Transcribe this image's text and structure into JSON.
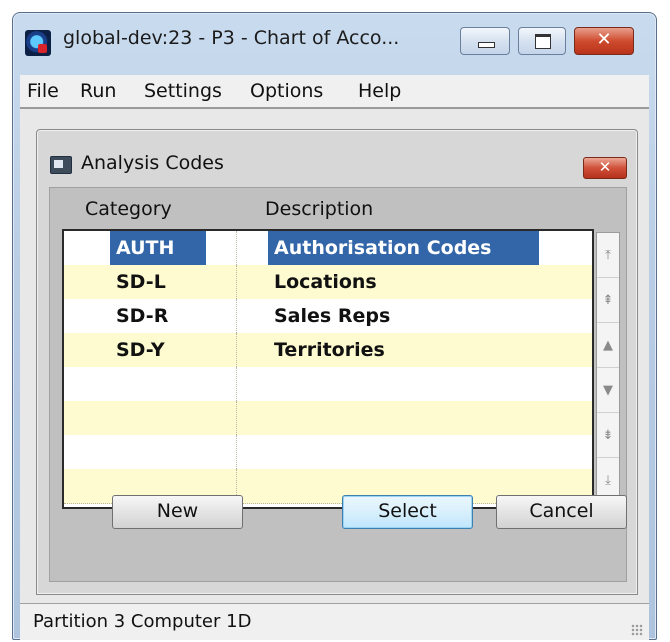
{
  "window": {
    "title": "global-dev:23 - P3 - Chart of Acco...",
    "minimize_glyph": "",
    "maximize_glyph": "",
    "close_glyph": "✕"
  },
  "menu": [
    "File",
    "Run",
    "Settings",
    "Options",
    "Help"
  ],
  "dialog": {
    "title": "Analysis Codes",
    "close_glyph": "✕",
    "columns": {
      "category": "Category",
      "description": "Description"
    },
    "rows": [
      {
        "category": "AUTH",
        "description": "Authorisation Codes",
        "selected": true
      },
      {
        "category": "SD-L",
        "description": "Locations",
        "selected": false
      },
      {
        "category": "SD-R",
        "description": "Sales Reps",
        "selected": false
      },
      {
        "category": "SD-Y",
        "description": "Territories",
        "selected": false
      },
      {
        "category": "",
        "description": "",
        "selected": false
      },
      {
        "category": "",
        "description": "",
        "selected": false
      },
      {
        "category": "",
        "description": "",
        "selected": false
      },
      {
        "category": "",
        "description": "",
        "selected": false
      }
    ],
    "scroll_buttons": [
      {
        "name": "scroll-top-icon",
        "glyph": "⤒"
      },
      {
        "name": "scroll-page-up-icon",
        "glyph": "⇞"
      },
      {
        "name": "scroll-up-icon",
        "glyph": "▲"
      },
      {
        "name": "scroll-down-icon",
        "glyph": "▼"
      },
      {
        "name": "scroll-page-down-icon",
        "glyph": "⇟"
      },
      {
        "name": "scroll-bottom-icon",
        "glyph": "⤓"
      }
    ],
    "buttons": {
      "new": "New",
      "select": "Select",
      "cancel": "Cancel"
    },
    "colors": {
      "selection": "#3366a8",
      "row_alt": "#fffbd0",
      "row": "#ffffff"
    }
  },
  "status": {
    "text": "Partition 3 Computer 1D"
  }
}
